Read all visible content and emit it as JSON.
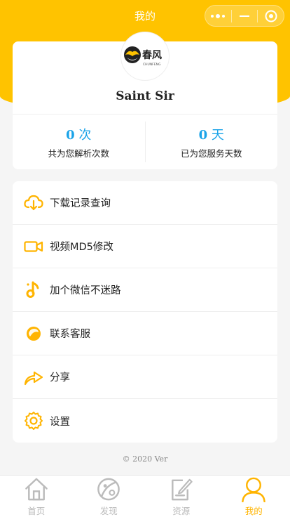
{
  "header": {
    "title": "我的"
  },
  "profile": {
    "logo_text": "春风",
    "logo_subtext": "CHUNFENG",
    "username": "Saint Sir",
    "stats": [
      {
        "value": "0",
        "unit": "次",
        "label": "共为您解析次数"
      },
      {
        "value": "0",
        "unit": "天",
        "label": "已为您服务天数"
      }
    ]
  },
  "menu": {
    "items": [
      {
        "label": "下载记录查询",
        "icon": "cloud-download-icon"
      },
      {
        "label": "视频MD5修改",
        "icon": "video-camera-icon"
      },
      {
        "label": "加个微信不迷路",
        "icon": "music-note-icon"
      },
      {
        "label": "联系客服",
        "icon": "customer-service-icon"
      },
      {
        "label": "分享",
        "icon": "share-arrow-icon"
      },
      {
        "label": "设置",
        "icon": "settings-gear-icon"
      }
    ]
  },
  "footer": {
    "copyright": "© 2020 Ver"
  },
  "tabbar": {
    "items": [
      {
        "label": "首页",
        "icon": "home-icon",
        "active": false
      },
      {
        "label": "发现",
        "icon": "planet-icon",
        "active": false
      },
      {
        "label": "资源",
        "icon": "edit-document-icon",
        "active": false
      },
      {
        "label": "我的",
        "icon": "user-icon",
        "active": true
      }
    ]
  },
  "colors": {
    "primary": "#ffc300",
    "accent_blue": "#1aa3e8",
    "icon_yellow": "#ffb400",
    "tab_inactive": "#bbbbbb"
  }
}
